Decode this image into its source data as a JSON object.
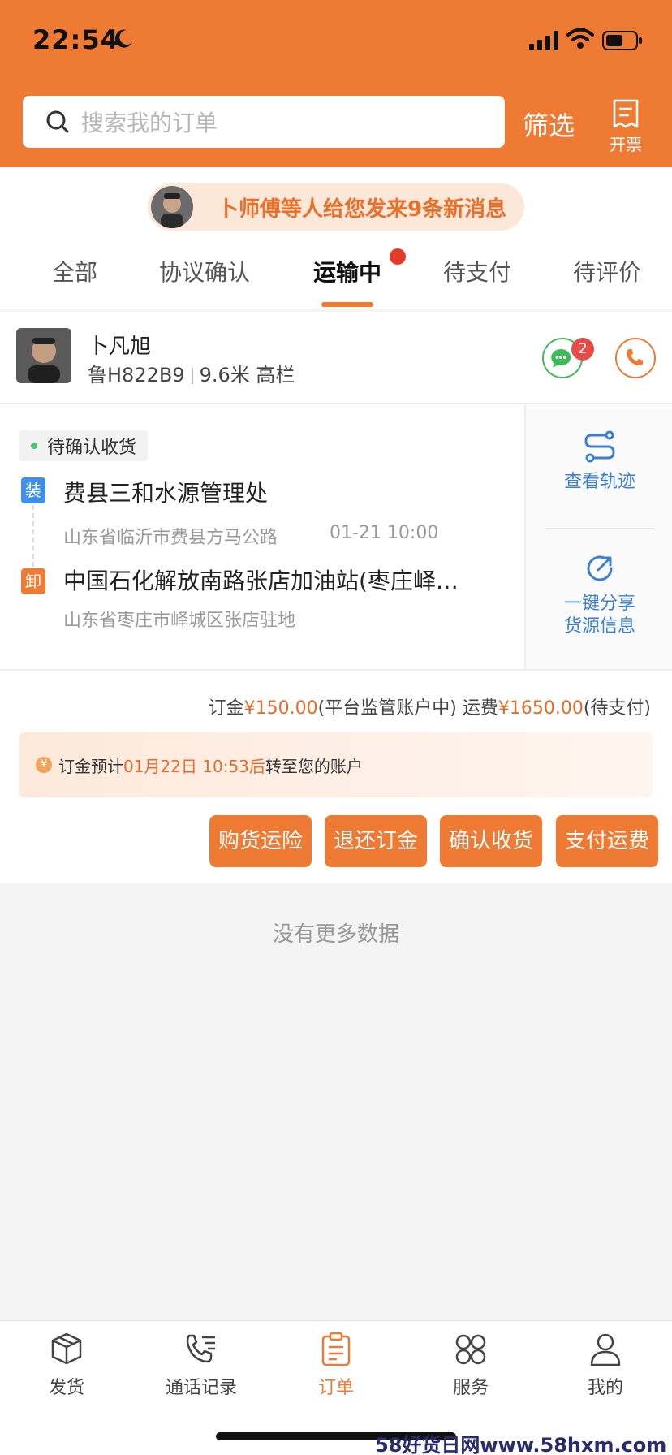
{
  "status_bar": {
    "time": "22:54"
  },
  "header": {
    "search_placeholder": "搜索我的订单",
    "filter_label": "筛选",
    "invoice_label": "开票"
  },
  "notice": {
    "text": "卜师傅等人给您发来9条新消息"
  },
  "tabs": [
    {
      "label": "全部",
      "active": false
    },
    {
      "label": "协议确认",
      "active": false
    },
    {
      "label": "运输中",
      "active": true,
      "has_dot": true
    },
    {
      "label": "待支付",
      "active": false
    },
    {
      "label": "待评价",
      "active": false
    }
  ],
  "order": {
    "driver": {
      "name": "卜凡旭",
      "plate": "鲁H822B9",
      "truck": "9.6米 高栏",
      "chat_badge": "2"
    },
    "status": "待确认收货",
    "load": {
      "badge": "装",
      "name": "费县三和水源管理处",
      "address": "山东省临沂市费县方马公路",
      "time": "01-21 10:00"
    },
    "unload": {
      "badge": "卸",
      "name": "中国石化解放南路张店加油站(枣庄峄…",
      "address": "山东省枣庄市峄城区张店驻地"
    },
    "side_actions": {
      "track": "查看轨迹",
      "share_line1": "一键分享",
      "share_line2": "货源信息"
    },
    "fees": {
      "deposit_label": "订金",
      "deposit_amount": "¥150.00",
      "deposit_note": "(平台监管账户中)",
      "freight_label": "运费",
      "freight_amount": "¥1650.00",
      "freight_note": "(待支付)"
    },
    "deposit_notice": {
      "coin": "¥",
      "prefix": "订金预计",
      "time": "01月22日 10:53后",
      "suffix": "转至您的账户"
    },
    "buttons": [
      "购货运险",
      "退还订金",
      "确认收货",
      "支付运费"
    ]
  },
  "list_end": "没有更多数据",
  "tabbar": [
    {
      "label": "发货",
      "icon": "box-icon",
      "active": false
    },
    {
      "label": "通话记录",
      "icon": "phone-list-icon",
      "active": false
    },
    {
      "label": "订单",
      "icon": "clipboard-icon",
      "active": true
    },
    {
      "label": "服务",
      "icon": "grid-flower-icon",
      "active": false
    },
    {
      "label": "我的",
      "icon": "user-icon",
      "active": false
    }
  ],
  "watermark": "58好货日网www.58hxm.com",
  "colors": {
    "brand": "#ef7a33",
    "link": "#3d7fd0",
    "badge": "#e64b45"
  }
}
